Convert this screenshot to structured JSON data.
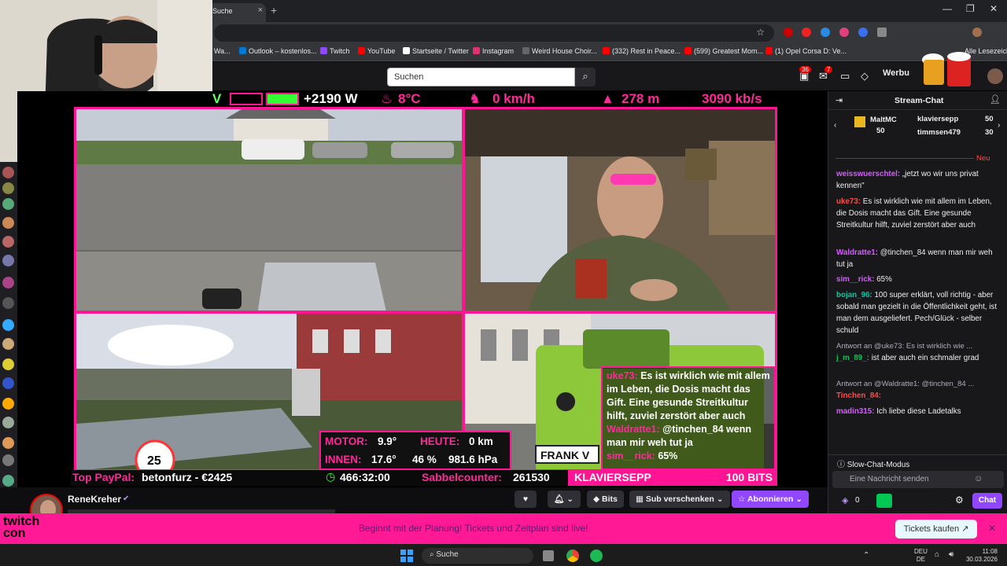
{
  "browser": {
    "tab_title": "Suche",
    "tab_close": "×",
    "new_tab": "+",
    "window_controls": [
      "—",
      "❐",
      "✕"
    ],
    "bookmarks": [
      {
        "label": "Wa...",
        "color": "#555"
      },
      {
        "label": "Outlook – kostenlos...",
        "color": "#0078d4"
      },
      {
        "label": "Twitch",
        "color": "#9147ff"
      },
      {
        "label": "YouTube",
        "color": "#ff0000"
      },
      {
        "label": "Startseite / Twitter",
        "color": "#000000"
      },
      {
        "label": "Instagram",
        "color": "#e1306c"
      },
      {
        "label": "Weird House Choir...",
        "color": "#333"
      },
      {
        "label": "(332) Rest in Peace...",
        "color": "#ff0000"
      },
      {
        "label": "(599) Greatest Mom...",
        "color": "#ff0000"
      },
      {
        "label": "(1) Opel Corsa D: Ve...",
        "color": "#ff0000"
      }
    ],
    "bookmarks_right": "Alle Lesezeichen"
  },
  "topnav": {
    "search_placeholder": "Suchen",
    "notif_count_1": "36",
    "notif_count_2": "7",
    "ad_label": "Werbu"
  },
  "stream": {
    "hud": {
      "power": "+2190 W",
      "temp": "8°C",
      "speed": "0 km/h",
      "altitude": "278 m",
      "bitrate": "3090 kb/s",
      "left_fragment": "V"
    },
    "weather": {
      "motor_label": "MOTOR:",
      "motor_value": "9.9°",
      "heute_label": "HEUTE:",
      "heute_value": "0 km",
      "innen_label": "INNEN:",
      "innen_value": "17.6°",
      "humidity": "46 %",
      "pressure": "981.6 hPa"
    },
    "chat_overlay": [
      {
        "user": "uke73:",
        "text": "Es ist wirklich wie mit allem im Leben, die Dosis macht das Gift. Eine gesunde Streitkultur hilft, zuviel zerstört aber auch"
      },
      {
        "user": "Waldratte1:",
        "text": "@tinchen_84 wenn man mir weh tut ja"
      },
      {
        "user": "sim__rick:",
        "text": "65%"
      }
    ],
    "ticker": {
      "paypal_label": "Top PayPal:",
      "paypal_value": "betonfurz - €2425",
      "timer": "466:32:00",
      "sabbel_label": "Sabbelcounter:",
      "sabbel_value": "261530",
      "bits_user": "KLAVIERSEPP",
      "bits_value": "100 BITS"
    },
    "plate": "FRANK V",
    "sign_25": "25"
  },
  "channel": {
    "name": "ReneKreher",
    "follow_icon": "heart-icon",
    "bell_icon": "bell-icon",
    "bits_label": "Bits",
    "gift_label": "Sub verschenken",
    "subscribe_label": "Abonnieren"
  },
  "chat": {
    "title": "Stream-Chat",
    "gift_leaders": [
      {
        "name": "MaltMC",
        "count": "50"
      },
      {
        "name": "klaviersepp",
        "count": "50"
      },
      {
        "name": "timmsen479",
        "count": "30"
      }
    ],
    "new_label": "Neu",
    "messages": [
      {
        "user": "weisswuerschtel:",
        "color": "#d65cff",
        "text": "„jetzt wo wir uns privat kennen\""
      },
      {
        "user": "uke73:",
        "color": "#ff4a4a",
        "text": "Es ist wirklich wie mit allem im Leben, die Dosis macht das Gift. Eine gesunde Streitkultur hilft, zuviel zerstört aber auch"
      },
      {
        "user": "Waldratte1:",
        "color": "#d65cff",
        "text": "@tinchen_84 wenn man mir weh tut ja"
      },
      {
        "user": "sim__rick:",
        "color": "#d65cff",
        "text": "65%"
      },
      {
        "user": "bojan_96:",
        "color": "#00c8a0",
        "text": "100 super erklärt, voll richtig - aber sobald man gezielt in die Öffentlichkeit geht, ist man dem ausgeliefert. Pech/Glück - selber schuld"
      },
      {
        "reply": "Antwort an @uke73: Es ist wirklich wie ..."
      },
      {
        "user": "j_m_89_:",
        "color": "#00c853",
        "text": "ist aber auch ein schmaler grad"
      },
      {
        "reply": "Antwort an @Waldratte1: @tinchen_84 ..."
      },
      {
        "user": "Tinchen_84:",
        "color": "#ff4a4a",
        "text": ""
      },
      {
        "user": "madin315:",
        "color": "#d65cff",
        "text": "Ich liebe diese Ladetalks"
      }
    ],
    "slow_mode": "Slow-Chat-Modus",
    "input_placeholder": "Eine Nachricht senden",
    "points": "0",
    "chat_button": "Chat"
  },
  "banner": {
    "logo_line1": "twitch",
    "logo_line2": "con",
    "text": "Beginnt mit der Planung! Tickets und Zeitplan sind live!",
    "cta": "Tickets kaufen",
    "close": "✕"
  },
  "taskbar": {
    "search": "Suche",
    "lang1": "DEU",
    "lang2": "DE",
    "time": "11:08",
    "date": "30.03.2026"
  }
}
